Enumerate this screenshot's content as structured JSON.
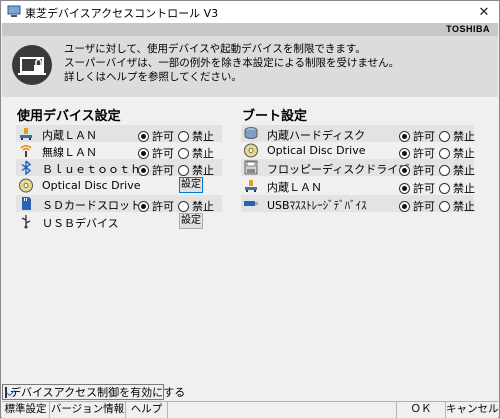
{
  "window": {
    "title": "東芝デバイスアクセスコントロール V3",
    "close_glyph": "✕"
  },
  "header": {
    "brand": "TOSHIBA",
    "description": [
      "ユーザに対して、使用デバイスや起動デバイスを制限できます。",
      "スーパーバイザは、一部の例外を除き本設定による制限を受けません。",
      "詳しくはヘルプを参照してください。"
    ]
  },
  "device_settings": {
    "title": "使用デバイス設定",
    "rows": [
      {
        "icon": "lan-icon",
        "label": "内蔵ＬＡＮ",
        "type": "radio",
        "selected": "許可"
      },
      {
        "icon": "wireless-lan-icon",
        "label": "無線ＬＡＮ",
        "type": "radio",
        "selected": "許可"
      },
      {
        "icon": "bluetooth-icon",
        "label": "Ｂｌｕｅｔｏｏｔｈ",
        "type": "radio",
        "selected": "許可"
      },
      {
        "icon": "optical-disc-icon",
        "label": "Optical Disc Drive",
        "type": "button",
        "button": "設定"
      },
      {
        "icon": "sd-card-icon",
        "label": "ＳＤカードスロット",
        "type": "radio",
        "selected": "許可"
      },
      {
        "icon": "usb-icon",
        "label": "ＵＳＢデバイス",
        "type": "button",
        "button": "設定"
      }
    ]
  },
  "boot_settings": {
    "title": "ブート設定",
    "rows": [
      {
        "icon": "hard-disk-icon",
        "label": "内蔵ハードディスク",
        "selected": "許可"
      },
      {
        "icon": "optical-disc-icon",
        "label": "Optical Disc Drive",
        "selected": "許可"
      },
      {
        "icon": "floppy-icon",
        "label": "フロッピーディスクドライブ",
        "selected": "許可"
      },
      {
        "icon": "lan-icon",
        "label": "内蔵ＬＡＮ",
        "selected": "許可"
      },
      {
        "icon": "usb-storage-icon",
        "label": "USBﾏｽｽﾄﾚｰｼﾞﾃﾞﾊﾞｲｽ",
        "selected": "許可"
      }
    ]
  },
  "options": {
    "allow": "許可",
    "deny": "禁止"
  },
  "enable_access_control": {
    "label": "デバイスアクセス制御を有効にする",
    "checked": true
  },
  "footer": {
    "default_button": "標準設定",
    "version_button": "バージョン情報",
    "help_button": "ヘルプ",
    "ok_button": "ＯＫ",
    "cancel_button": "キャンセル"
  },
  "colors": {
    "header_band": "#dcdcdc",
    "row_shade": "#e3e3e3",
    "focus_border": "#0078d7"
  }
}
